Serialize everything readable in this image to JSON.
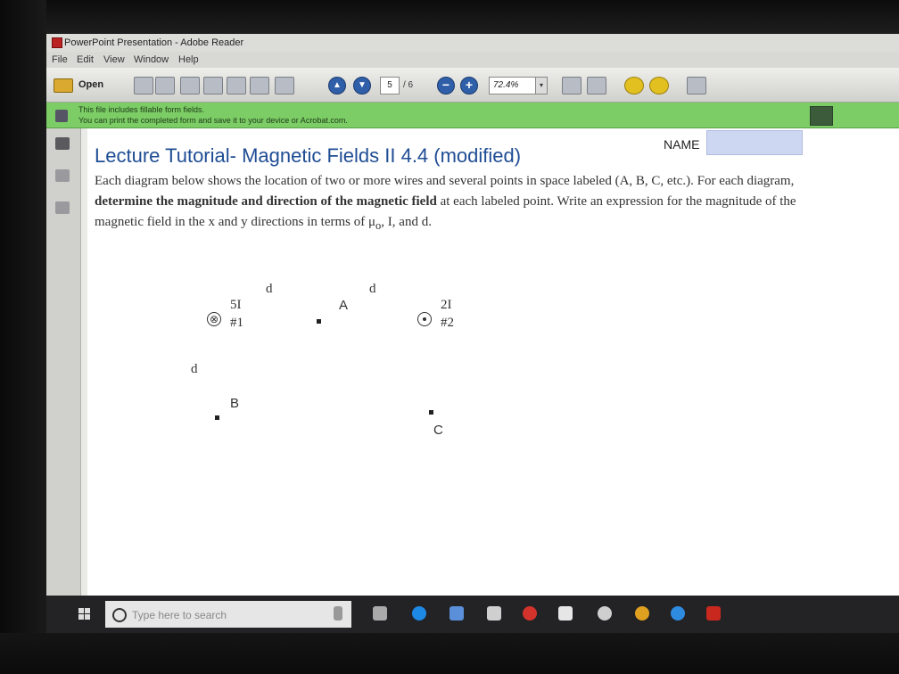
{
  "window": {
    "title": "PowerPoint Presentation - Adobe Reader"
  },
  "menu": [
    "File",
    "Edit",
    "View",
    "Window",
    "Help"
  ],
  "toolbar": {
    "open_label": "Open",
    "page_current": "5",
    "page_total": "/ 6",
    "zoom": "72.4%"
  },
  "notification": {
    "line1": "This file includes fillable form fields.",
    "line2": "You can print the completed form and save it to your device or Acrobat.com."
  },
  "document": {
    "title": "Lecture Tutorial- Magnetic Fields II 4.4 (modified)",
    "name_label": "NAME",
    "instructions": {
      "part1": "Each diagram below shows the location of two or more wires and several points in space labeled (A, B, C, etc.). For each diagram, ",
      "bold": "determine the magnitude and direction of the magnetic field",
      "part2": " at each labeled point. Write an expression for the magnitude of the magnetic field in the x and y directions in terms of μ",
      "sub": "o",
      "part3": ", I, and d."
    },
    "diagram": {
      "spacing_label": "d",
      "wire1_current": "5I",
      "wire1_id": "#1",
      "wire1_symbol": "⊗",
      "wire2_current": "2I",
      "wire2_id": "#2",
      "point_a": "A",
      "point_b": "B",
      "point_c": "C"
    }
  },
  "taskbar": {
    "search_placeholder": "Type here to search"
  },
  "colors": {
    "title_blue": "#1f4d94",
    "notify_green": "#7ccd66",
    "name_field": "#cdd7f2"
  }
}
